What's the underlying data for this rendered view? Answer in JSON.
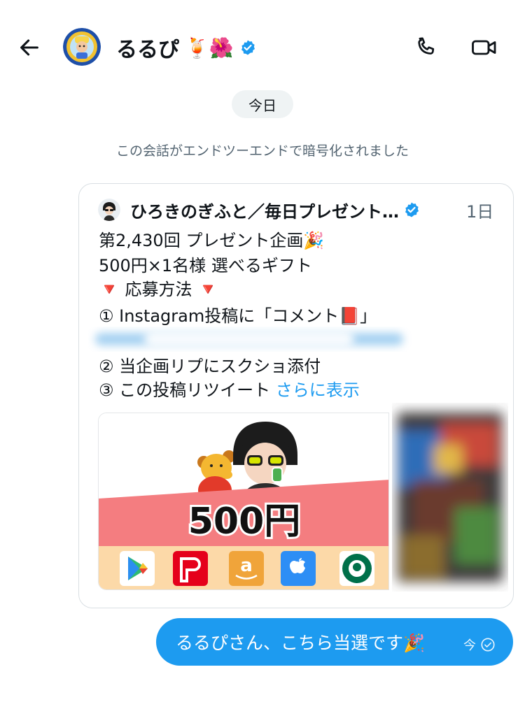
{
  "header": {
    "contact_name": "るるぴ",
    "name_emojis": "🍹🌺",
    "verified": true
  },
  "chat": {
    "date_label": "今日",
    "encryption_notice": "この会話がエンドツーエンドで暗号化されました"
  },
  "tweet": {
    "author": "ひろきのぎふと／毎日プレゼント…",
    "time": "1日",
    "lines": [
      "第2,430回 プレゼント企画🎉",
      "500円×1名様 選べるギフト",
      "🔻 応募方法 🔻",
      "① Instagram投稿に「コメント📕」",
      "② 当企画リプにスクショ添付",
      "③ この投稿リツイート"
    ],
    "show_more": "さらに表示",
    "media": {
      "amount": "500円"
    }
  },
  "message": {
    "text": "るるぴさん、こちら当選です🎉",
    "time": "今"
  },
  "colors": {
    "accent": "#1d9bf0",
    "banner": "#f47d80",
    "text": "#0f1419",
    "muted": "#536471"
  }
}
